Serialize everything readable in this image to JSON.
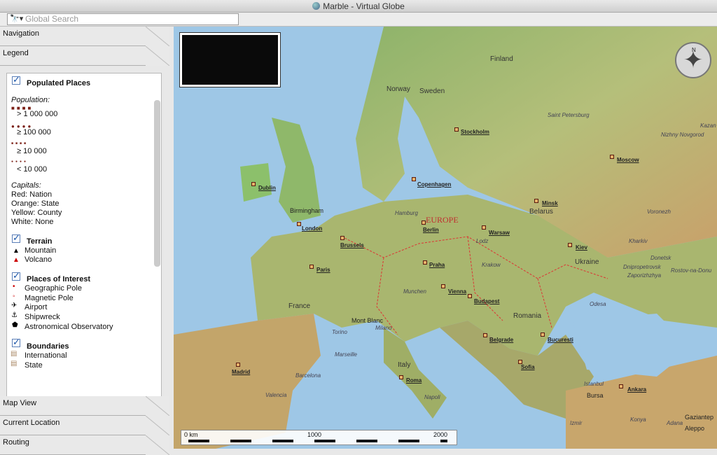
{
  "window": {
    "title": "Marble - Virtual Globe"
  },
  "search": {
    "placeholder": "Global Search"
  },
  "sidebar": {
    "tabs_top": [
      "Navigation",
      "Legend"
    ],
    "tabs_bottom": [
      "Map View",
      "Current Location",
      "Routing"
    ]
  },
  "legend": {
    "populated_places": {
      "heading": "Populated Places",
      "population_label": "Population:",
      "ranges": [
        "> 1 000 000",
        "≥ 100 000",
        "≥ 10 000",
        "< 10 000"
      ]
    },
    "capitals": {
      "label": "Capitals:",
      "items": [
        "Red: Nation",
        "Orange: State",
        "Yellow: County",
        "White: None"
      ]
    },
    "terrain": {
      "heading": "Terrain",
      "items": [
        "Mountain",
        "Volcano"
      ]
    },
    "poi": {
      "heading": "Places of Interest",
      "items": [
        "Geographic Pole",
        "Magnetic Pole",
        "Airport",
        "Shipwreck",
        "Astronomical Observatory"
      ]
    },
    "boundaries": {
      "heading": "Boundaries",
      "items": [
        "International",
        "State"
      ]
    }
  },
  "map": {
    "region_label": "EUROPE",
    "countries": [
      "Finland",
      "Norway",
      "Sweden",
      "Belarus",
      "Ukraine",
      "France",
      "Romania",
      "Italy"
    ],
    "cities_underlined": [
      "Stockholm",
      "Copenhagen",
      "Dublin",
      "Moscow",
      "Minsk",
      "London",
      "Berlin",
      "Warsaw",
      "Brussels",
      "Kiev",
      "Paris",
      "Praha",
      "Vienna",
      "Budapest",
      "Belgrade",
      "Bucuresti",
      "Madrid",
      "Sofia",
      "Roma",
      "Ankara"
    ],
    "cities_plain": [
      "Saint Petersburg",
      "Nizhny Novgorod",
      "Kazan",
      "Birmingham",
      "Hamburg",
      "Voronezh",
      "Lodz",
      "Kharkiv",
      "Krakow",
      "Donetsk",
      "Dnipropetrovsk",
      "Rostov-na-Donu",
      "Zaporizhzhya",
      "Munchen",
      "Mont Blanc",
      "Milano",
      "Torino",
      "Odesa",
      "Marseille",
      "Barcelona",
      "Valencia",
      "Napoli",
      "Istanbul",
      "Bursa",
      "Izmir",
      "Konya",
      "Adana",
      "Gaziantep",
      "Aleppo"
    ],
    "scale": {
      "labels": [
        "0 km",
        "1000",
        "2000"
      ]
    }
  }
}
